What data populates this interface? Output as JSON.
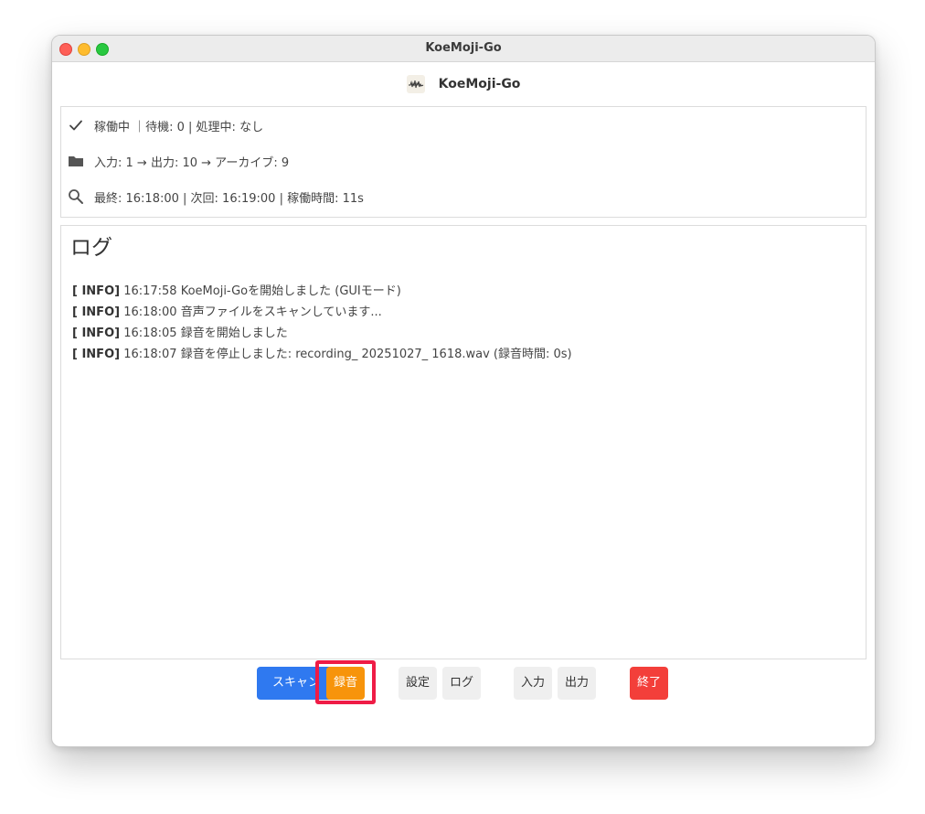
{
  "window": {
    "title": "KoeMoji-Go"
  },
  "app_header": {
    "name": "KoeMoji-Go",
    "logo_icon": "waveform-logo-icon"
  },
  "status": {
    "rows": [
      {
        "icon": "check-icon",
        "text": "稼働中 ｜待機: 0 | 処理中: なし"
      },
      {
        "icon": "folder-icon",
        "text": "入力: 1 → 出力: 10 → アーカイブ: 9"
      },
      {
        "icon": "search-icon",
        "text": "最終: 16:18:00 | 次回: 16:19:00 | 稼働時間: 11s"
      }
    ]
  },
  "log": {
    "title": "ログ",
    "lines": [
      {
        "level": "[ INFO]",
        "message": " 16:17:58 KoeMoji-Goを開始しました (GUIモード)"
      },
      {
        "level": "[ INFO]",
        "message": " 16:18:00 音声ファイルをスキャンしています..."
      },
      {
        "level": "[ INFO]",
        "message": " 16:18:05 録音を開始しました"
      },
      {
        "level": "[ INFO]",
        "message": " 16:18:07 録音を停止しました: recording_ 20251027_ 1618.wav (録音時間: 0s)"
      }
    ]
  },
  "toolbar": {
    "scan_label": "スキャン",
    "record_label": "録音",
    "settings_label": "設定",
    "log_label": "ログ",
    "input_label": "入力",
    "output_label": "出力",
    "quit_label": "終了"
  },
  "colors": {
    "scan_button": "#2f79f0",
    "record_button": "#f7940b",
    "quit_button": "#f33f3a",
    "highlight": "#ef1c46"
  }
}
